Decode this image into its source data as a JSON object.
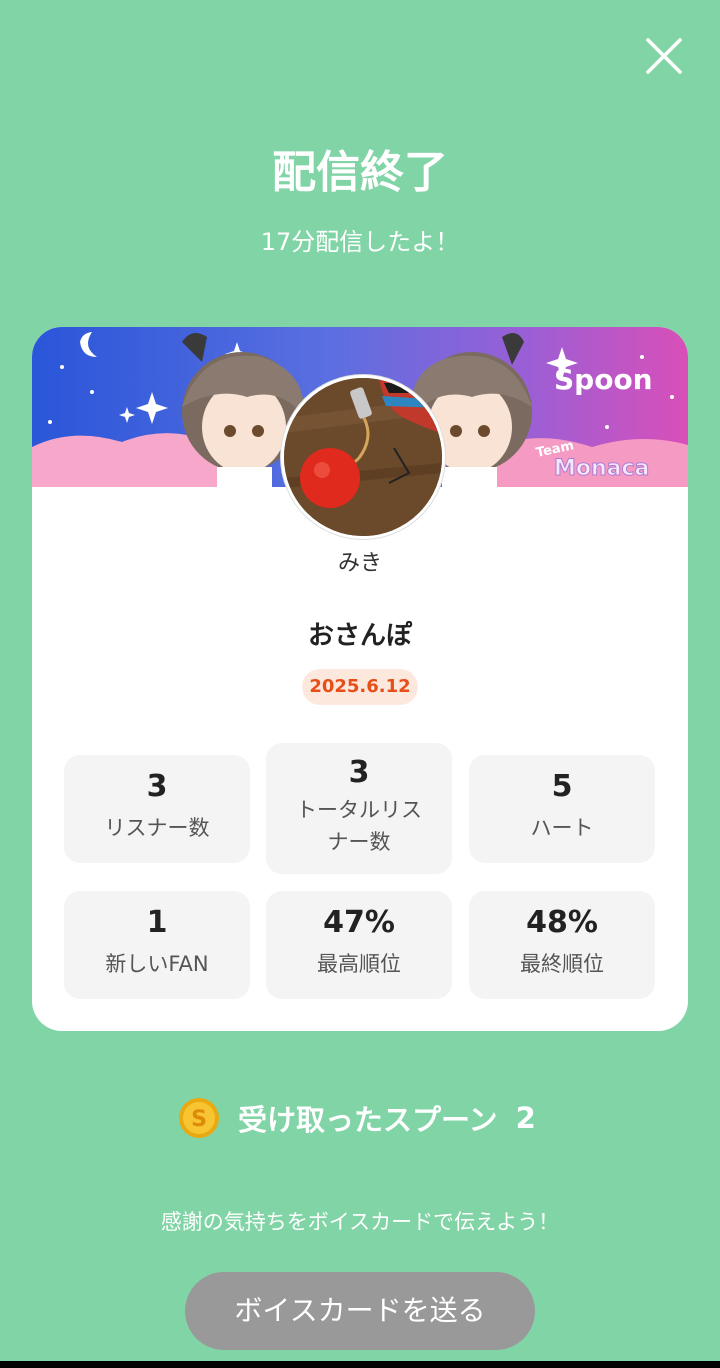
{
  "header": {
    "title": "配信終了",
    "subtitle": "17分配信したよ！"
  },
  "card": {
    "banner": {
      "brand": "Spoon",
      "team_label": "Team",
      "team_name": "Monaca"
    },
    "username": "みき",
    "stream_title": "おさんぽ",
    "date": "2025.6.12",
    "stats": [
      {
        "value": "3",
        "label": "リスナー数"
      },
      {
        "value": "3",
        "label": "トータルリスナー数"
      },
      {
        "value": "5",
        "label": "ハート"
      },
      {
        "value": "1",
        "label": "新しいFAN"
      },
      {
        "value": "47%",
        "label": "最高順位"
      },
      {
        "value": "48%",
        "label": "最終順位"
      }
    ]
  },
  "spoons": {
    "icon": "spoon-coin-icon",
    "label": "受け取ったスプーン",
    "count": "2"
  },
  "thanks_message": "感謝の気持ちをボイスカードで伝えよう！",
  "voice_card_button": "ボイスカードを送る",
  "colors": {
    "background": "#81d4a6",
    "date_text": "#e84e17",
    "date_bg": "#fde8de",
    "button_bg": "#999999"
  }
}
